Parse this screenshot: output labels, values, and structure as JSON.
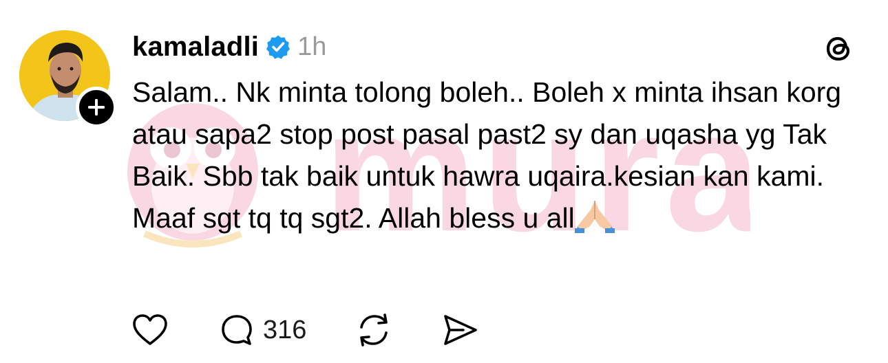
{
  "post": {
    "username": "kamaladli",
    "timestamp": "1h",
    "text": "Salam.. Nk minta tolong boleh.. Boleh x minta ihsan korg atau sapa2 stop post pasal past2 sy dan uqasha yg Tak Baik. Sbb tak baik untuk hawra uqaira.kesian kan kami. Maaf sgt tq tq sgt2. Allah bless u all",
    "emoji": "folded-hands",
    "verified": true
  },
  "actions": {
    "like_icon": "heart-icon",
    "reply_icon": "comment-icon",
    "reply_count": "316",
    "repost_icon": "repost-icon",
    "share_icon": "send-icon"
  },
  "watermark": {
    "text": "murai"
  },
  "colors": {
    "avatar_bg": "#f3c51b",
    "verified": "#1d9bf0",
    "timestamp": "#9a9a9a",
    "watermark": "#f4c9d8"
  }
}
